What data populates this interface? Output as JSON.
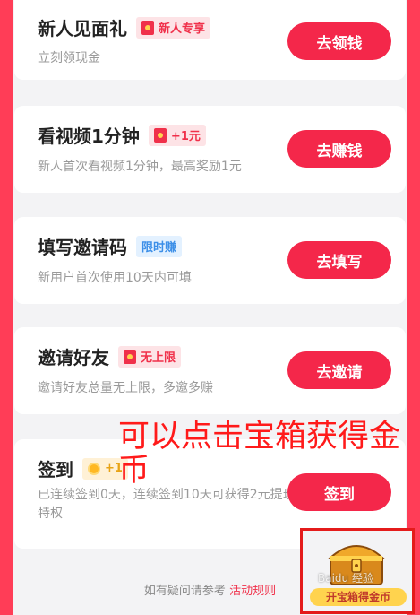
{
  "tasks": [
    {
      "title": "新人见面礼",
      "badge": "新人专享",
      "desc": "立刻领现金",
      "button": "去领钱"
    },
    {
      "title": "看视频1分钟",
      "badge": "+1元",
      "desc": "新人首次看视频1分钟，最高奖励1元",
      "button": "去赚钱"
    },
    {
      "title": "填写邀请码",
      "badge": "限时赚",
      "desc": "新用户首次使用10天内可填",
      "button": "去填写"
    },
    {
      "title": "邀请好友",
      "badge": "无上限",
      "desc": "邀请好友总量无上限，多邀多赚",
      "button": "去邀请"
    },
    {
      "title": "签到",
      "badge": "+1",
      "desc": "已连续签到0天，连续签到10天可获得2元提现特权",
      "button": "签到"
    }
  ],
  "footer": {
    "text": "如有疑问请参考",
    "link": "活动规则"
  },
  "overlay": {
    "text": "可以点击宝箱获得金币"
  },
  "chest": {
    "label": "开宝箱得金币"
  },
  "watermark": "Baidu 经验",
  "colors": {
    "accent": "#f4274a",
    "border": "#e41b1b",
    "overlay_text": "#ff1a1a"
  }
}
